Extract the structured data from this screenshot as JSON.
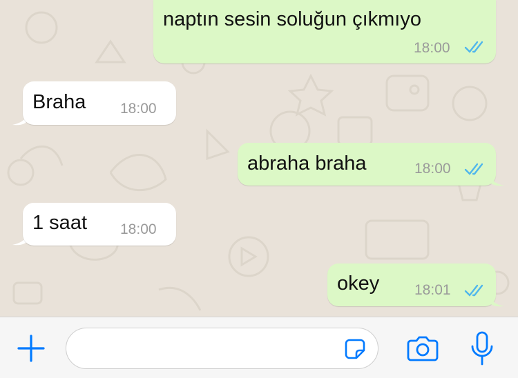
{
  "colors": {
    "outgoing_bubble": "#dcf8c6",
    "incoming_bubble": "#ffffff",
    "read_ticks": "#4fb6ec",
    "accent_blue": "#007aff",
    "wallpaper": "#e9e2d9"
  },
  "messages": [
    {
      "direction": "outgoing",
      "text": "naptın sesin soluğun çıkmıyo",
      "time": "18:00",
      "status_icon": "double-check-read-icon"
    },
    {
      "direction": "incoming",
      "text": "Braha",
      "time": "18:00"
    },
    {
      "direction": "outgoing",
      "text": "abraha braha",
      "time": "18:00",
      "status_icon": "double-check-read-icon"
    },
    {
      "direction": "incoming",
      "text": "1 saat",
      "time": "18:00"
    },
    {
      "direction": "outgoing",
      "text": "okey",
      "time": "18:01",
      "status_icon": "double-check-read-icon"
    }
  ],
  "input_bar": {
    "attach_icon": "plus-icon",
    "message_value": "",
    "sticker_icon": "sticker-icon",
    "camera_icon": "camera-icon",
    "mic_icon": "microphone-icon"
  }
}
